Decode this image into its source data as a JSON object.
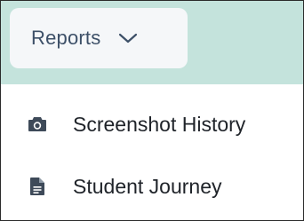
{
  "nav": {
    "reports_label": "Reports",
    "dropdown_icon": "chevron-down-icon",
    "items": [
      {
        "label": "Screenshot History",
        "icon": "camera-icon"
      },
      {
        "label": "Student Journey",
        "icon": "document-icon"
      }
    ]
  },
  "colors": {
    "topbar_bg": "#c4e3dc",
    "tab_bg": "#f5f7f9",
    "tab_text": "#3d5068",
    "item_text": "#1f2329",
    "icon": "#3e4a59"
  }
}
